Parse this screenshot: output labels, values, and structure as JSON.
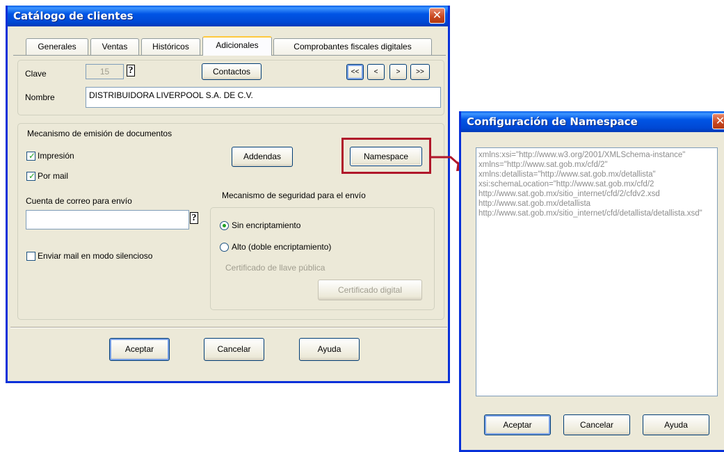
{
  "main_dialog": {
    "title": "Catálogo de clientes",
    "close_glyph": "✕",
    "tabs": [
      {
        "label": "Generales"
      },
      {
        "label": "Ventas"
      },
      {
        "label": "Históricos"
      },
      {
        "label": "Adicionales",
        "active": true
      },
      {
        "label": "Comprobantes fiscales digitales"
      }
    ],
    "clave_label": "Clave",
    "clave_value": "15",
    "help_glyph": "?",
    "contactos_button": "Contactos",
    "nav_buttons": [
      "<<",
      "<",
      ">",
      ">>"
    ],
    "nombre_label": "Nombre",
    "nombre_value": "DISTRIBUIDORA LIVERPOOL S.A. DE C.V.",
    "mecanismo_title": "Mecanismo de emisión de documentos",
    "impresion_label": "Impresión",
    "impresion_checked": true,
    "por_mail_label": "Por mail",
    "por_mail_checked": true,
    "addendas_button": "Addendas",
    "namespace_button": "Namespace",
    "cuenta_label": "Cuenta de correo para envío",
    "cuenta_value": "",
    "silencioso_label": "Enviar mail en modo silencioso",
    "silencioso_checked": false,
    "seguridad_title": "Mecanismo de seguridad para el envío",
    "sin_encriptamiento_label": "Sin encriptamiento",
    "alto_label": "Alto (doble encriptamiento)",
    "selected_security": "sin_encriptamiento",
    "certificado_label": "Certificado de llave pública",
    "certificado_button": "Certificado digital",
    "aceptar_button": "Aceptar",
    "cancelar_button": "Cancelar",
    "ayuda_button": "Ayuda"
  },
  "namespace_dialog": {
    "title": "Configuración de Namespace",
    "close_glyph": "✕",
    "namespace_text": "xmlns:xsi=\"http://www.w3.org/2001/XMLSchema-instance\" xmlns=\"http://www.sat.gob.mx/cfd/2\"\nxmlns:detallista=\"http://www.sat.gob.mx/detallista\"\nxsi:schemaLocation=\"http://www.sat.gob.mx/cfd/2\nhttp://www.sat.gob.mx/sitio_internet/cfd/2/cfdv2.xsd\nhttp://www.sat.gob.mx/detallista\nhttp://www.sat.gob.mx/sitio_internet/cfd/detallista/detallista.xsd\"",
    "aceptar_button": "Aceptar",
    "cancelar_button": "Cancelar",
    "ayuda_button": "Ayuda"
  },
  "colors": {
    "title_bar": "#0055e5",
    "dialog_face": "#ece9d8",
    "highlight": "#b0172a",
    "check_green": "#21a121"
  }
}
